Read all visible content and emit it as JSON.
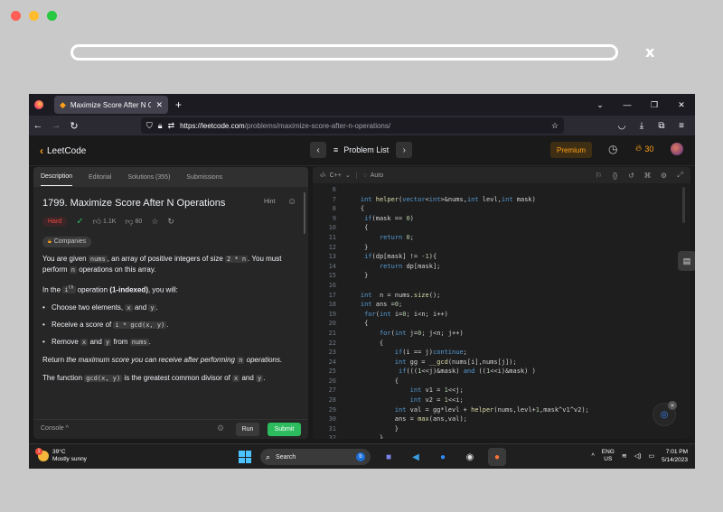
{
  "colors": {
    "mac_red": "#ff5f57",
    "mac_yellow": "#febc2e",
    "mac_green": "#28c840",
    "accent": "#ffa116",
    "hard": "#ef4743",
    "submit": "#2cbb5d"
  },
  "outer": {
    "close_label": "x"
  },
  "browser": {
    "tab_title": "Maximize Score After N Operat",
    "tab_close": "✕",
    "new_tab": "+",
    "url_host": "https://leetcode.com",
    "url_path": "/problems/maximize-score-after-n-operations/"
  },
  "lc": {
    "logo_text": "LeetCode",
    "problem_list_label": "Problem List",
    "premium_label": "Premium",
    "streak_count": "30"
  },
  "left": {
    "tabs": [
      "Description",
      "Editorial",
      "Solutions (355)",
      "Submissions"
    ],
    "title": "1799. Maximize Score After N Operations",
    "hint_label": "Hint",
    "difficulty": "Hard",
    "likes": "1.1K",
    "dislikes": "80",
    "companies_label": "Companies",
    "console_label": "Console ^",
    "run_label": "Run",
    "submit_label": "Submit"
  },
  "desc": {
    "p1_a": "You are given ",
    "p1_code1": "nums",
    "p1_b": ", an array of positive integers of size ",
    "p1_code2": "2 * n",
    "p1_c": ". You must perform ",
    "p1_code3": "n",
    "p1_d": " operations on this array.",
    "p2_a": "In the ",
    "p2_code": "i",
    "p2_sup": "th",
    "p2_b": " operation ",
    "p2_bold": "(1-indexed)",
    "p2_c": ", you will:",
    "li1_a": "Choose two elements, ",
    "li1_c1": "x",
    "li1_b": " and ",
    "li1_c2": "y",
    "li1_end": ".",
    "li2_a": "Receive a score of ",
    "li2_c": "i * gcd(x, y)",
    "li2_end": ".",
    "li3_a": "Remove ",
    "li3_c1": "x",
    "li3_b": " and ",
    "li3_c2": "y",
    "li3_mid": " from ",
    "li3_c3": "nums",
    "li3_end": ".",
    "p3_a": "Return ",
    "p3_i": "the maximum score you can receive after performing ",
    "p3_code": "n",
    "p3_b": " operations.",
    "p4_a": "The function ",
    "p4_code1": "gcd(x, y)",
    "p4_b": " is the greatest common divisor of ",
    "p4_code2": "x",
    "p4_c": " and ",
    "p4_code3": "y",
    "p4_end": "."
  },
  "editor": {
    "lang": "C++",
    "mode": "Auto",
    "lines": [
      {
        "n": "6",
        "t": ""
      },
      {
        "n": "7",
        "t": "    int helper(vector<int>&nums,int levl,int mask)"
      },
      {
        "n": "8",
        "t": "    {"
      },
      {
        "n": "9",
        "t": "     if(mask == 0)"
      },
      {
        "n": "10",
        "t": "     {"
      },
      {
        "n": "11",
        "t": "         return 0;"
      },
      {
        "n": "12",
        "t": "     }"
      },
      {
        "n": "13",
        "t": "     if(dp[mask] != -1){"
      },
      {
        "n": "14",
        "t": "         return dp[mask];"
      },
      {
        "n": "15",
        "t": "     }"
      },
      {
        "n": "16",
        "t": ""
      },
      {
        "n": "17",
        "t": "    int  n = nums.size();"
      },
      {
        "n": "18",
        "t": "    int ans =0;"
      },
      {
        "n": "19",
        "t": "     for(int i=0; i<n; i++)"
      },
      {
        "n": "20",
        "t": "     {"
      },
      {
        "n": "21",
        "t": "         for(int j=0; j<n; j++)"
      },
      {
        "n": "22",
        "t": "         {"
      },
      {
        "n": "23",
        "t": "             if(i == j)continue;"
      },
      {
        "n": "24",
        "t": "             int gg = __gcd(nums[i],nums[j]);"
      },
      {
        "n": "25",
        "t": "              if(((1<<j)&mask) and ((1<<i)&mask) )"
      },
      {
        "n": "26",
        "t": "             {"
      },
      {
        "n": "27",
        "t": "                 int v1 = 1<<j;"
      },
      {
        "n": "28",
        "t": "                 int v2 = 1<<i;"
      },
      {
        "n": "29",
        "t": "             int val = gg*levl + helper(nums,levl+1,mask^v1^v2);"
      },
      {
        "n": "30",
        "t": "             ans = max(ans,val);"
      },
      {
        "n": "31",
        "t": "             }"
      },
      {
        "n": "32",
        "t": "         }"
      }
    ]
  },
  "taskbar": {
    "temp": "39°C",
    "weather": "Mostly sunny",
    "weather_badge": "1",
    "search_label": "Search",
    "lang_top": "ENG",
    "lang_bottom": "US",
    "time": "7:01 PM",
    "date": "5/14/2023"
  }
}
